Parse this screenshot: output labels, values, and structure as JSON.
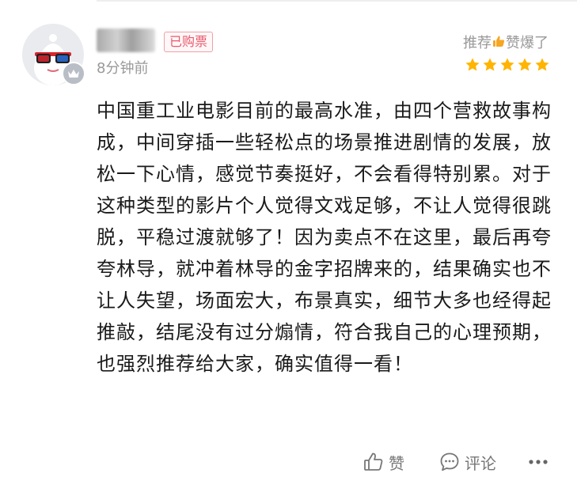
{
  "comment": {
    "purchased_badge": "已购票",
    "time": "8分钟前",
    "rating_prefix": "推荐",
    "rating_suffix": "赞爆了",
    "stars": 5,
    "star_color": "#ffb400",
    "body": "中国重工业电影目前的最高水准，由四个营救故事构成，中间穿插一些轻松点的场景推进剧情的发展，放松一下心情，感觉节奏挺好，不会看得特别累。对于这种类型的影片个人觉得文戏足够，不让人觉得很跳脱，平稳过渡就够了！因为卖点不在这里，最后再夸夸林导，就冲着林导的金字招牌来的，结果确实也不让人失望，场面宏大，布景真实，细节大多也经得起推敲，结尾没有过分煽情，符合我自己的心理预期，也强烈推荐给大家，确实值得一看！"
  },
  "actions": {
    "like_label": "赞",
    "comment_label": "评论",
    "like_icon": "thumbs-up-icon",
    "comment_icon": "speech-bubble-icon",
    "more_icon": "more-dots-icon"
  },
  "colors": {
    "badge_text": "#e85a6c",
    "muted_text": "#999999",
    "avatar_bg": "#e9ebef"
  }
}
